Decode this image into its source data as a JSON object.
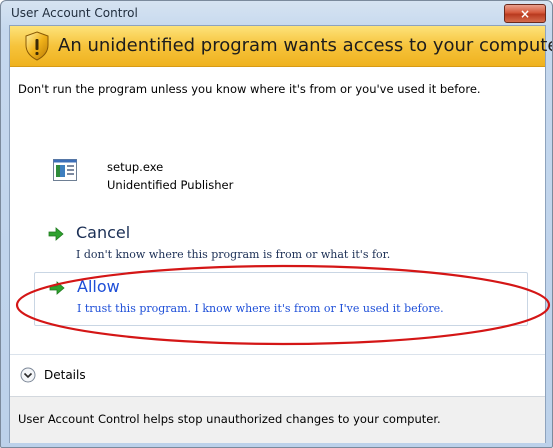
{
  "window": {
    "title": "User Account Control",
    "close_label": "×"
  },
  "banner": {
    "text": "An unidentified program wants access to your computer",
    "icon": "shield-warning-icon"
  },
  "description": "Don't run the program unless you know where it's from or you've used it before.",
  "program": {
    "name": "setup.exe",
    "publisher": "Unidentified Publisher",
    "icon": "program-icon"
  },
  "options": {
    "cancel": {
      "title": "Cancel",
      "description": "I don't know where this program is from or what it's for."
    },
    "allow": {
      "title": "Allow",
      "description": "I trust this program. I know where it's from or I've used it before."
    }
  },
  "details": {
    "label": "Details"
  },
  "footer": {
    "text": "User Account Control helps stop unauthorized changes to your computer."
  },
  "colors": {
    "banner": "#f6c33b",
    "link_blue": "#1e4fd8",
    "arrow_green": "#2ea22e",
    "annotation_red": "#d41616"
  }
}
